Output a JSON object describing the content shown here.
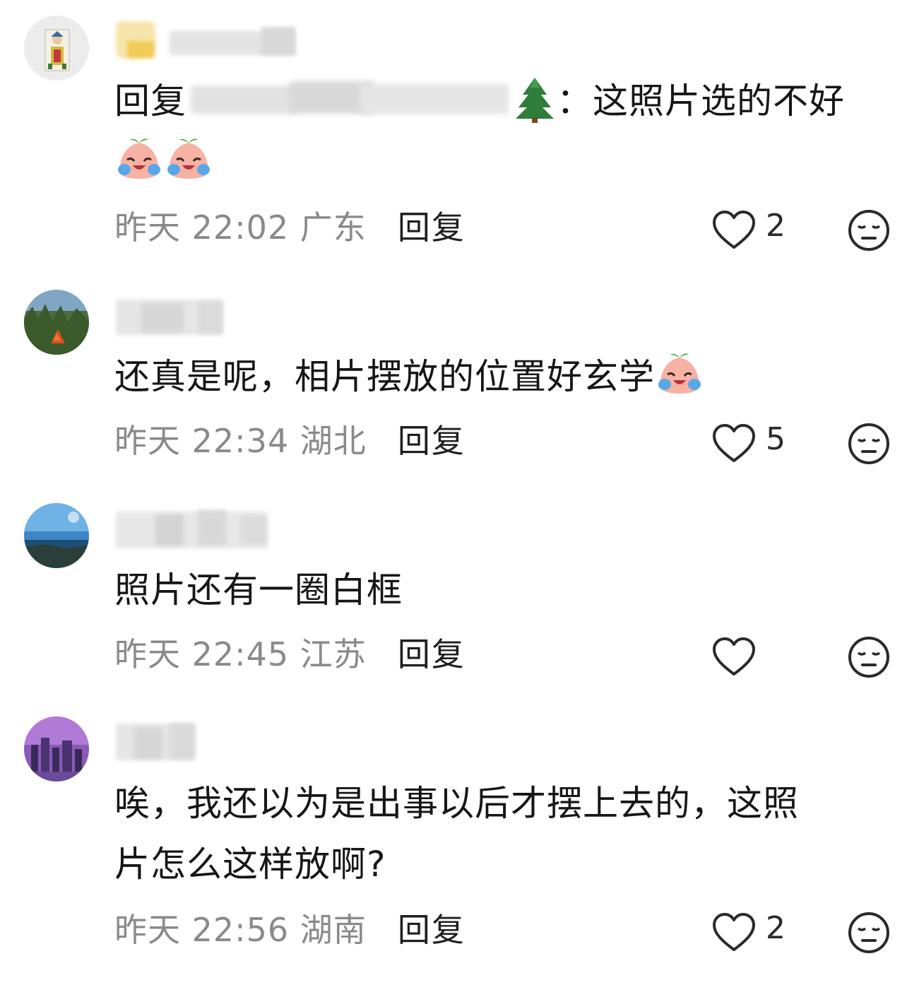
{
  "comments": [
    {
      "reply_prefix": "回复",
      "text": "：这照片选的不好",
      "time_location": "昨天 22:02 广东",
      "reply_label": "回复",
      "likes": "2",
      "emoji": "crying-laughing-peach"
    },
    {
      "text": "还真是呢，相片摆放的位置好玄学",
      "time_location": "昨天 22:34 湖北",
      "reply_label": "回复",
      "likes": "5",
      "emoji": "crying-laughing-peach"
    },
    {
      "text": "照片还有一圈白框",
      "time_location": "昨天 22:45 江苏",
      "reply_label": "回复",
      "likes": ""
    },
    {
      "text_line1": "唉，我还以为是出事以后才摆上去的，这照",
      "text_line2": "片怎么这样放啊?",
      "time_location": "昨天 22:56 湖南",
      "reply_label": "回复",
      "likes": "2"
    }
  ],
  "icons": {
    "like": "heart-outline-icon",
    "dislike": "unamused-face-icon",
    "tree": "evergreen-tree-emoji"
  },
  "colors": {
    "text": "#161616",
    "meta": "#8a8a8a",
    "icon": "#2a2a2a"
  }
}
